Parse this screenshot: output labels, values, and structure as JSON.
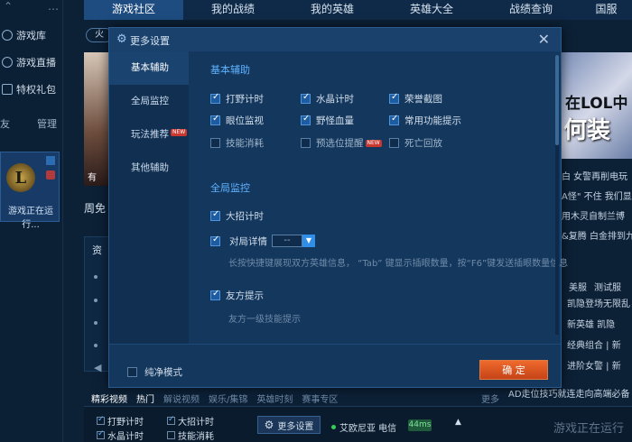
{
  "sidebar": {
    "items": [
      {
        "label": "游戏库",
        "icon": "library-icon"
      },
      {
        "label": "游戏直播",
        "icon": "live-icon"
      },
      {
        "label": "特权礼包",
        "icon": "gift-icon"
      }
    ],
    "row_left": "友",
    "row_right": "管理",
    "game_status": "游戏正在运行..."
  },
  "topnav": {
    "tabs": [
      "游戏社区",
      "我的战绩",
      "我的英雄",
      "英雄大全",
      "战绩查询",
      "国服"
    ]
  },
  "subtab": "火",
  "background": {
    "banner_title_1": "在LOL中",
    "banner_title_2": "何装",
    "banner_left_caption": "有",
    "left_heading": "周免",
    "left_box_heading": "资",
    "right_news": [
      "白 女警再削电玩",
      "A怪\" 不住 我们显",
      "用木灵自制兰博",
      "&复腾 白金排到九"
    ],
    "right_tabs": [
      "美服",
      "测试服"
    ],
    "right_rows": [
      "凯隐登场无限乱",
      "新英雄 凯隐",
      "经典组合 | 新",
      "进阶女警 | 新"
    ],
    "bottom_line": "AD走位技巧就连走向高端必备",
    "content_tabs": [
      "精彩视频",
      "热门",
      "解说视频",
      "娱乐/集锦",
      "英雄时刻",
      "赛事专区",
      "更多"
    ]
  },
  "bottombar": {
    "checks": [
      {
        "label": "打野计时",
        "checked": true
      },
      {
        "label": "水晶计时",
        "checked": true
      },
      {
        "label": "大招计时",
        "checked": true
      },
      {
        "label": "技能消耗",
        "checked": false
      }
    ],
    "settings_button": "更多设置",
    "server": "艾欧尼亚 电信",
    "ping": "44ms",
    "status": "游戏正在运行"
  },
  "dialog": {
    "title": "更多设置",
    "nav": [
      {
        "label": "基本辅助",
        "active": true,
        "new": false
      },
      {
        "label": "全局监控",
        "active": false,
        "new": false
      },
      {
        "label": "玩法推荐",
        "active": false,
        "new": true
      },
      {
        "label": "其他辅助",
        "active": false,
        "new": false
      }
    ],
    "new_tag": "NEW",
    "section1_title": "基本辅助",
    "basic_options": [
      {
        "label": "打野计时",
        "checked": true
      },
      {
        "label": "水晶计时",
        "checked": true
      },
      {
        "label": "荣誉截图",
        "checked": true
      },
      {
        "label": "眼位监视",
        "checked": true
      },
      {
        "label": "野怪血量",
        "checked": true
      },
      {
        "label": "常用功能提示",
        "checked": true
      },
      {
        "label": "技能消耗",
        "checked": false
      },
      {
        "label": "预选位提醒",
        "checked": false,
        "new": true
      },
      {
        "label": "死亡回放",
        "checked": false
      }
    ],
    "section2_title": "全局监控",
    "global_options": [
      {
        "label": "大招计时",
        "checked": true
      },
      {
        "label": "对局详情",
        "checked": true
      },
      {
        "label": "友方提示",
        "checked": true
      }
    ],
    "detail_select_value": "--",
    "detail_hint": "长按快捷键展现双方英雄信息， “Tab” 键显示插眼数量，按“F6”键发送插眼数量信息",
    "ally_hint": "友方一级技能提示",
    "pure_mode": "纯净模式",
    "confirm": "确 定"
  },
  "colors": {
    "accent": "#5fb3ff",
    "confirm": "#e2592a",
    "dialog_bg": "#14375e"
  }
}
